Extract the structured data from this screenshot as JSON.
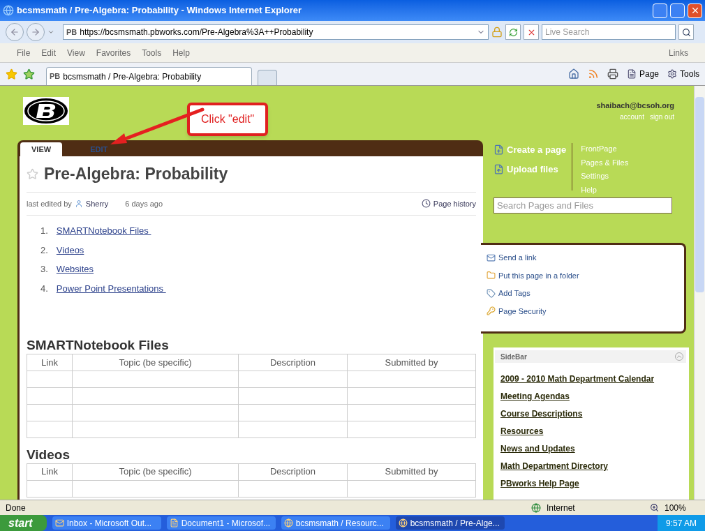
{
  "window": {
    "title": "bcsmsmath / Pre-Algebra:  Probability - Windows Internet Explorer"
  },
  "address_bar": {
    "site_label": "PB",
    "url": "https://bcsmsmath.pbworks.com/Pre-Algebra%3A++Probability",
    "search_placeholder": "Live Search"
  },
  "menu": [
    "File",
    "Edit",
    "View",
    "Favorites",
    "Tools",
    "Help"
  ],
  "links_label": "Links",
  "browser_tabs": [
    {
      "site_label": "PB",
      "title": "bcsmsmath / Pre-Algebra:  Probability",
      "selected": true
    }
  ],
  "command_bar": {
    "page": "Page",
    "tools": "Tools"
  },
  "account": {
    "email": "shaibach@bcsoh.org",
    "links": [
      "account",
      "sign out"
    ]
  },
  "annotation": {
    "text": "Click \"edit\""
  },
  "page_tabs": [
    {
      "label": "VIEW",
      "selected": true
    },
    {
      "label": "EDIT",
      "selected": false
    }
  ],
  "page": {
    "title": "Pre-Algebra:  Probability",
    "edited_prefix": "last edited by",
    "editor": "Sherry",
    "edited_when": "6 days ago",
    "history": "Page history",
    "contents": [
      {
        "number": "1.",
        "label": "SMARTNotebook Files "
      },
      {
        "number": "2.",
        "label": "Videos"
      },
      {
        "number": "3.",
        "label": "Websites"
      },
      {
        "number": "4.",
        "label": "Power Point Presentations "
      }
    ],
    "sections": [
      {
        "heading": "SMARTNotebook Files",
        "columns": [
          "Link",
          "Topic (be specific)",
          "Description",
          "Submitted by"
        ]
      },
      {
        "heading": "Videos",
        "columns": [
          "Link",
          "Topic (be specific)",
          "Description",
          "Submitted by"
        ]
      }
    ]
  },
  "actions": [
    {
      "kind": "create",
      "label": "Create a page"
    },
    {
      "kind": "upload",
      "label": "Upload files"
    }
  ],
  "nav": [
    "FrontPage",
    "Pages & Files",
    "Settings",
    "Help"
  ],
  "search": {
    "placeholder": "Search Pages and Files"
  },
  "page_tools": [
    {
      "kind": "mail",
      "label": "Send a link"
    },
    {
      "kind": "folder",
      "label": "Put this page in a folder"
    },
    {
      "kind": "tag",
      "label": "Add Tags"
    },
    {
      "kind": "key",
      "label": "Page Security"
    }
  ],
  "sidebar": {
    "title": "SideBar",
    "links": [
      "2009 - 2010 Math Department Calendar",
      "Meeting Agendas",
      "Course Descriptions",
      "Resources",
      "News and Updates",
      "Math Department Directory",
      "PBworks Help Page"
    ]
  },
  "status_bar": {
    "text": "Done",
    "zone": "Internet",
    "zoom": "100%"
  },
  "taskbar": {
    "start": "start",
    "tasks": [
      {
        "kind": "mail",
        "label": "Inbox - Microsoft Out...",
        "selected": false
      },
      {
        "kind": "doc",
        "label": "Document1 - Microsof...",
        "selected": false
      },
      {
        "kind": "ie",
        "label": "bcsmsmath / Resourc...",
        "selected": false
      },
      {
        "kind": "ie",
        "label": "bcsmsmath / Pre-Alge...",
        "selected": true
      }
    ],
    "time": "9:57 AM"
  }
}
